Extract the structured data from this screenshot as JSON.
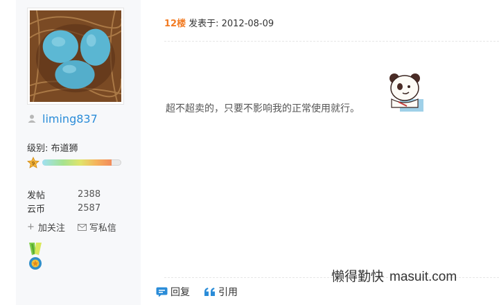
{
  "user": {
    "username": "liming837",
    "level_label": "级别: 布道狮",
    "level_badge_text": "9",
    "level_progress": 0.88,
    "stats": [
      {
        "key": "发帖",
        "value": "2388"
      },
      {
        "key": "云币",
        "value": "2587"
      }
    ],
    "actions": [
      {
        "label": "加关注",
        "icon": "plus-icon"
      },
      {
        "label": "写私信",
        "icon": "mail-icon"
      }
    ]
  },
  "post": {
    "floor": "12楼",
    "posted_at": "发表于: 2012-08-09",
    "content": "超不超卖的，只要不影响我的正常使用就行。"
  },
  "footer": {
    "reply_label": "回复",
    "quote_label": "引用"
  },
  "watermark": {
    "text": "懒得勤快",
    "site": "masuit.com"
  },
  "colors": {
    "username": "#2a8cd8",
    "floor": "#f27b23",
    "action_icon": "#2a8cd8"
  }
}
